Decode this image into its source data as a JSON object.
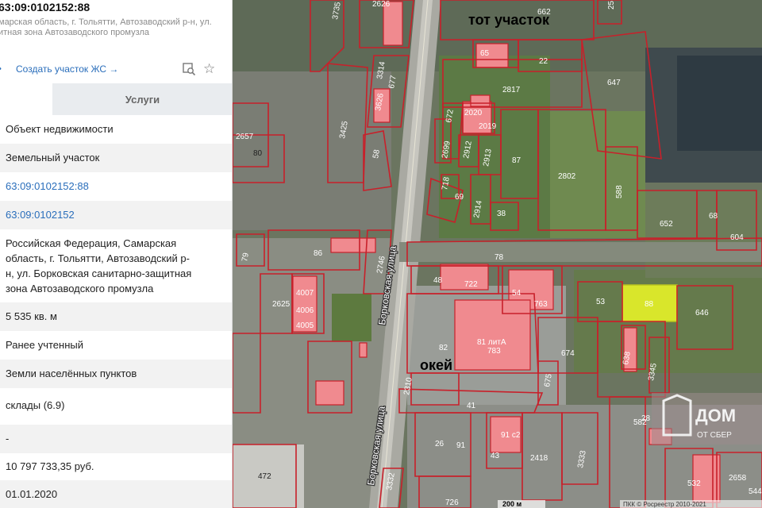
{
  "header": {
    "cadastral_number": "63:09:0102152:88",
    "address_lines": [
      "марская область, г. Тольятти, Автозаводский р-н, ул.",
      "итная зона Автозаводского промузла"
    ]
  },
  "actions": {
    "create_link": "Создать участок ЖС →",
    "search_icon": "search-location-icon",
    "star_icon": "star-icon",
    "bullet": "•"
  },
  "tabs": {
    "services_label": "Услуги"
  },
  "properties": [
    {
      "value": "Объект недвижимости",
      "link": false
    },
    {
      "value": "Земельный участок",
      "link": false
    },
    {
      "value": "63:09:0102152:88",
      "link": true
    },
    {
      "value": "63:09:0102152",
      "link": true
    },
    {
      "value_lines": [
        "Российская Федерация, Самарская",
        "область, г. Тольятти, Автозаводский р-",
        "н, ул. Борковская санитарно-защитная",
        "зона Автозаводского промузла"
      ],
      "link": false
    },
    {
      "value": "5 535 кв. м",
      "link": false
    },
    {
      "value": "Ранее учтенный",
      "link": false
    },
    {
      "value": "Земли населённых пунктов",
      "link": false
    },
    {
      "value": "склады (6.9)",
      "link": false
    },
    {
      "value": "-",
      "link": false
    },
    {
      "value": "10 797 733,35 руб.",
      "link": false
    },
    {
      "value": "01.01.2020",
      "link": false
    }
  ],
  "map": {
    "annotations": {
      "top": "тот участок",
      "okey": "окей"
    },
    "street_label": "Борковская улица",
    "scale_label": "200 м",
    "copyright": "ПКК © Росреестр 2010-2021",
    "watermark_line1": "ДОМ",
    "watermark_line2": "ОТ СБЕР",
    "colors": {
      "parcel_border": "#c8202a",
      "building_fill": "#f08a8f",
      "selected_fill": "#d9e62b",
      "imagery_base": "#5f6a55"
    },
    "parcel_labels": [
      "3735",
      "2626",
      "662",
      "25",
      "65",
      "22",
      "647",
      "2817",
      "3314",
      "677",
      "3626",
      "3425",
      "2020",
      "2019",
      "672",
      "2699",
      "2912",
      "2913",
      "87",
      "2802",
      "588",
      "2657",
      "80",
      "58",
      "718",
      "2914",
      "69",
      "38",
      "652",
      "68",
      "604",
      "78",
      "79",
      "86",
      "2746",
      "48",
      "722",
      "54",
      "763",
      "53",
      "88",
      "646",
      "2625",
      "4007",
      "4006",
      "4005",
      "82",
      "81 литА",
      "783",
      "674",
      "638",
      "3345",
      "2310",
      "41",
      "675",
      "26",
      "91",
      "91 с2",
      "43",
      "2418",
      "3333",
      "582",
      "28",
      "472",
      "3332",
      "726",
      "532",
      "2658",
      "544"
    ]
  }
}
